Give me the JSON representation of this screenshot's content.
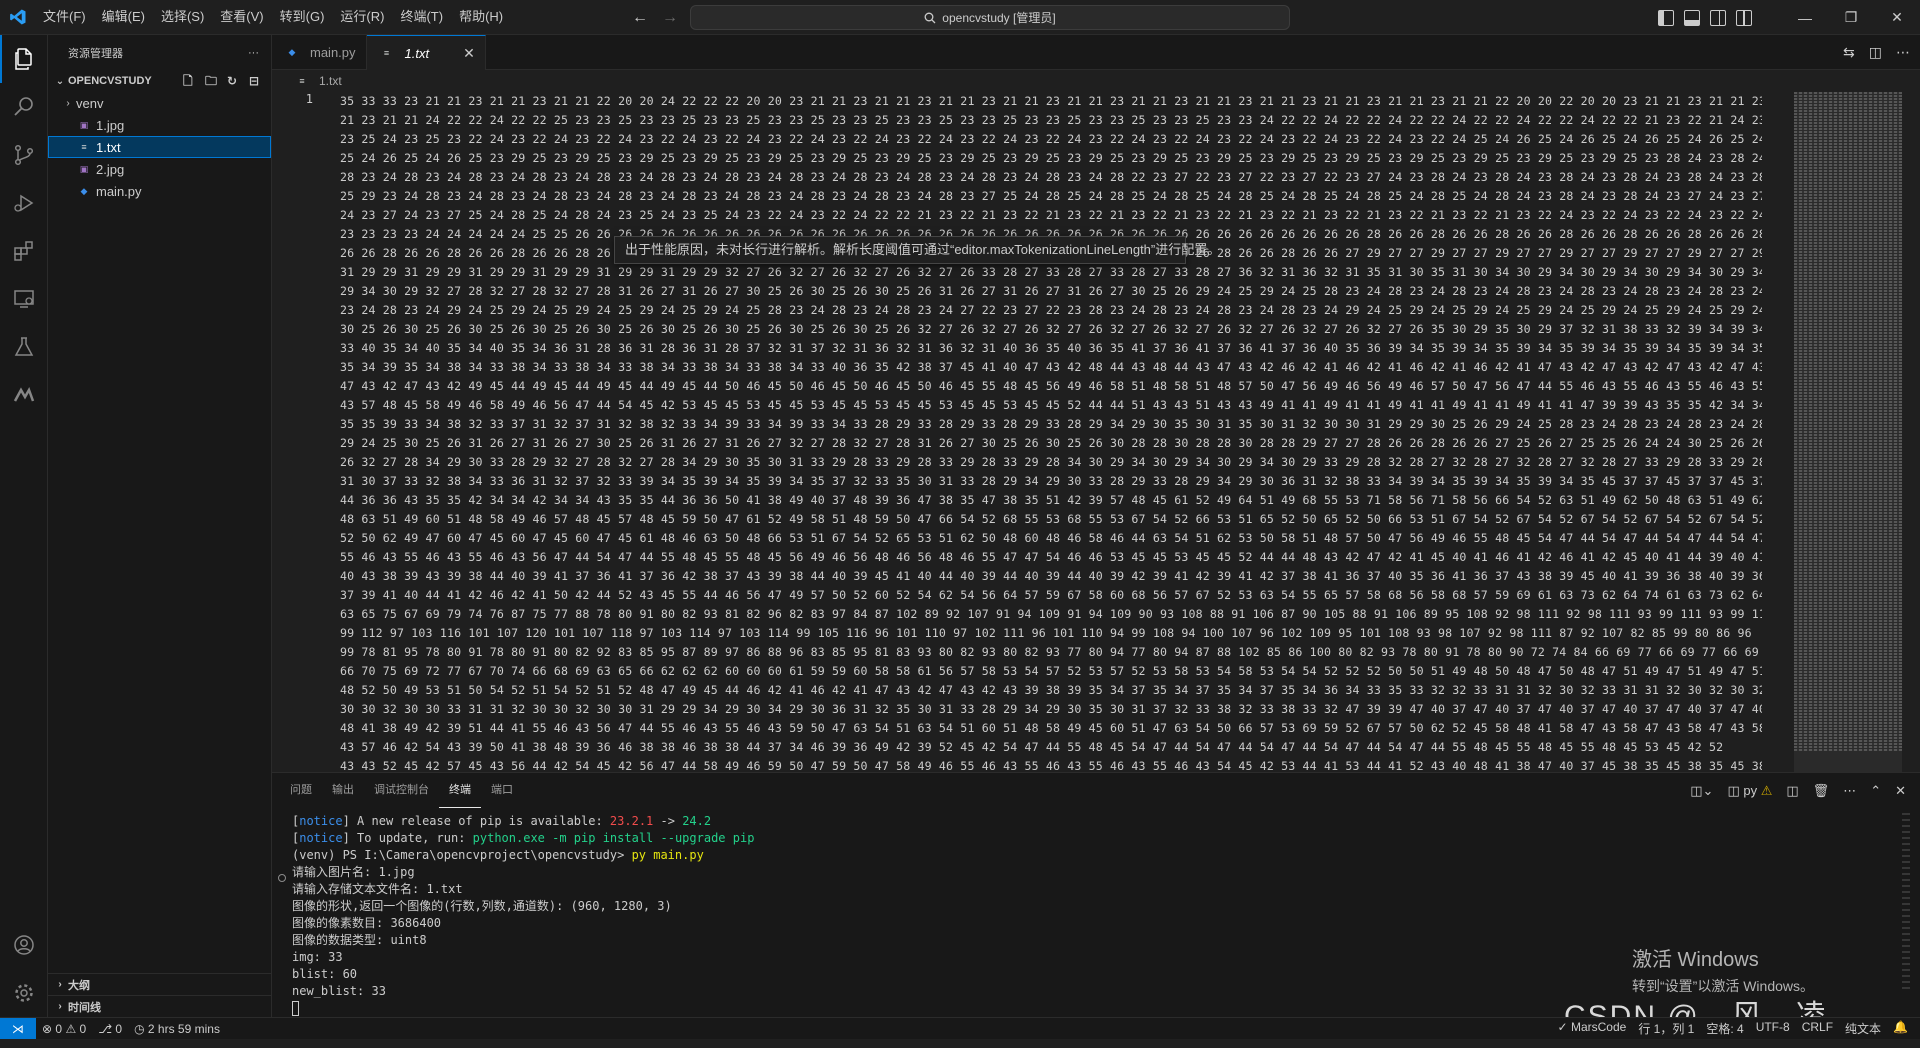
{
  "titlebar": {
    "menus": [
      "文件(F)",
      "编辑(E)",
      "选择(S)",
      "查看(V)",
      "转到(G)",
      "运行(R)",
      "终端(T)",
      "帮助(H)"
    ],
    "search_text": "opencvstudy [管理员]"
  },
  "sidebar": {
    "title": "资源管理器",
    "more": "···",
    "folder": "OPENCVSTUDY",
    "items": [
      {
        "label": "venv",
        "type": "folder"
      },
      {
        "label": "1.jpg",
        "type": "img"
      },
      {
        "label": "1.txt",
        "type": "txt",
        "selected": true
      },
      {
        "label": "2.jpg",
        "type": "img"
      },
      {
        "label": "main.py",
        "type": "py"
      }
    ],
    "outline": "大纲",
    "timeline": "时间线"
  },
  "tabs": [
    {
      "label": "main.py",
      "active": false
    },
    {
      "label": "1.txt",
      "active": true
    }
  ],
  "breadcrumb": "1.txt",
  "editor": {
    "line_number": "1",
    "tooltip": "出于性能原因，未对长行进行解析。解析长度阈值可通过“editor.maxTokenizationLineLength”进行配置。",
    "lines": [
      "35 33 33 23 21 21 23 21 21 23 21 21 22 20 20 24 22 22 22 20 20 23 21 21 23 21 21 23 21 21 23 21 21 23 21 21 23 21 21 23 21 21 23 21 21 23 21 21 23 21 21 23 21 21 22 20 20 22 20 20 23 21 21 23 21 21 23 21",
      "21 23 21 21 24 22 22 24 22 22 25 23 23 25 23 23 25 23 23 25 23 23 25 23 23 25 23 23 25 23 23 25 23 23 25 23 23 25 23 23 25 23 23 24 22 22 24 22 22 24 22 22 24 22 22 24 22 22 24 22 22 21 23 22 21 24 23 25 24",
      "23 25 24 23 25 23 22 24 23 22 24 23 22 24 23 22 24 23 22 24 23 22 24 23 22 24 23 22 24 23 22 24 23 22 24 23 22 24 23 22 24 23 22 24 23 22 24 23 22 24 23 22 24 25 24 26 25 24 26 25 24 26 25 24 26 25 24 26",
      "25 24 26 25 24 26 25 23 29 25 23 29 25 23 29 25 23 29 25 23 29 25 23 29 25 23 29 25 23 29 25 23 29 25 23 29 25 23 29 25 23 29 25 23 29 25 23 29 25 23 29 25 23 29 25 23 29 25 23 29 25 23 28 24 23 28 24 23",
      "28 23 24 28 23 24 28 23 24 28 23 24 28 23 24 28 23 24 28 23 24 28 23 24 28 23 24 28 23 24 28 23 24 28 23 24 28 22 23 27 22 23 27 22 23 27 22 23 27 24 23 28 24 23 28 24 23 28 24 23 28 24 23 28 24 23 28 24",
      "25 29 23 24 28 23 24 28 23 24 28 23 24 28 23 24 28 23 24 28 23 24 28 23 24 28 23 24 28 23 27 25 24 28 25 24 28 25 24 28 25 24 28 25 24 28 25 24 28 25 24 28 25 24 28 24 23 28 24 23 28 24 23 27 24 23 27 24",
      "24 23 27 24 23 27 25 24 28 25 24 28 24 23 25 24 23 25 24 23 22 24 23 22 24 22 22 21 23 22 21 23 22 21 23 22 21 23 22 21 23 22 21 23 22 21 23 22 21 23 22 21 23 22 21 23 22 24 23 22 24 23 22 24 23 22 24 23",
      "23 23 23 23 24 24 24 24 24 25 25 26 26 26 26 26 26 26 26 26 26 26 26 26 26 26 26 26 26 26 26 26 26 26 26 26 26 26 26 26 26 26 26 26 26 26 26 26 28 26 26 28 26 26 28 26 26 28 26 26 28 26 26 28 26 26 28 26",
      "26 26 28 26 26 28 26 26 28 26 26 28 26 26 28 26 26 28 26 26 28 26 26 28 26 26 28 26 26 28 26 26 28 26 26 28 26 26 28 26 26 28 26 26 28 26 26 27 29 27 27 29 27 27 29 27 27 29 27 27 29 27 27 29 27 27 29 27",
      "31 29 29 31 29 29 31 29 29 31 29 29 31 29 29 31 29 29 32 27 26 32 27 26 32 27 26 32 27 26 33 28 27 33 28 27 33 28 27 33 28 27 36 32 31 36 32 31 35 31 30 35 31 30 34 30 29 34 30 29 34 30 29 34 30 29 34 30",
      "29 34 30 29 32 27 28 32 27 28 32 27 28 31 26 27 31 26 27 30 25 26 30 25 26 30 25 26 31 26 27 31 26 27 31 26 27 30 25 26 29 24 25 29 24 25 28 23 24 28 23 24 28 23 24 28 23 24 28 23 24 28 23 24 28 23 24 28",
      "23 24 28 23 24 29 24 25 29 24 25 29 24 25 29 24 25 29 24 25 28 23 24 28 23 24 28 23 24 27 22 23 27 22 23 28 23 24 28 23 24 28 23 24 28 23 24 29 24 25 29 24 25 29 24 25 29 24 25 29 24 25 29 24 25 29 24 25",
      "30 25 26 30 25 26 30 25 26 30 25 26 30 25 26 30 25 26 30 25 26 30 25 26 30 25 26 32 27 26 32 27 26 32 27 26 32 27 26 32 27 26 32 27 26 32 27 26 32 27 26 35 30 29 35 30 29 37 32 31 38 33 32 39 34 39 34 39",
      "33 40 35 34 40 35 34 40 35 34 36 31 28 36 31 28 36 31 28 37 32 31 37 32 31 36 32 31 36 32 31 40 36 35 40 36 35 41 37 36 41 37 36 41 37 36 40 35 36 39 34 35 39 34 35 39 34 35 39 34 35 39 34 35 39 34 35 39",
      "35 34 39 35 34 38 34 33 38 34 33 38 34 33 38 34 33 38 34 33 38 34 33 40 36 35 42 38 37 45 41 40 47 43 42 48 44 43 48 44 43 47 43 42 46 42 41 46 42 41 46 42 41 46 42 41 47 43 42 47 43 42 47 43 42 47 43 42",
      "47 43 42 47 43 42 49 45 44 49 45 44 49 45 44 49 45 44 50 46 45 50 46 45 50 46 45 50 46 45 55 48 45 56 49 46 58 51 48 58 51 48 57 50 47 56 49 46 56 49 46 57 50 47 56 47 44 55 46 43 55 46 43 55 46 43 55 46",
      "43 57 48 45 58 49 46 58 49 46 56 47 44 54 45 42 53 45 45 53 45 45 53 45 45 53 45 45 53 45 45 53 45 45 52 44 44 51 43 43 51 43 43 49 41 41 49 41 41 49 41 41 49 41 41 49 41 41 47 39 39 43 35 35 42 34 34 43",
      "35 35 39 33 34 38 32 33 37 31 32 37 31 32 38 32 33 34 39 33 34 39 33 34 33 28 29 33 28 29 33 28 29 33 28 29 34 29 30 35 30 31 35 30 31 32 30 30 31 29 29 30 25 26 29 24 25 28 23 24 28 23 24 28 23 24 28 23",
      "29 24 25 30 25 26 31 26 27 31 26 27 30 25 26 31 26 27 31 26 27 32 27 28 32 27 28 31 26 27 30 25 26 30 25 26 30 28 28 30 28 28 30 28 28 29 27 27 28 26 26 28 26 26 27 25 26 27 25 25 26 24 24 30 25 26 26 24",
      "26 32 27 28 34 29 30 33 28 29 32 27 28 32 27 28 34 29 30 35 30 31 33 29 28 33 29 28 33 29 28 33 29 28 34 30 29 34 30 29 34 30 29 34 30 29 33 29 28 32 28 27 32 28 27 32 28 27 32 28 27 33 29 28 33 29 28 33",
      "31 30 37 33 32 38 34 33 36 31 32 37 32 33 39 34 35 39 34 35 39 34 35 37 32 33 35 30 31 33 28 29 34 29 30 33 28 29 33 28 29 34 29 30 36 31 32 38 33 34 39 34 35 39 34 35 39 34 35 45 37 37 45 37 37 45 37 37",
      "44 36 36 43 35 35 42 34 34 42 34 34 43 35 35 44 36 36 50 41 38 49 40 37 48 39 36 47 38 35 47 38 35 51 42 39 57 48 45 61 52 49 64 51 49 68 55 53 71 58 56 71 58 56 66 54 52 63 51 49 62 50 48 63 51 49 62 50",
      "48 63 51 49 60 51 48 58 49 46 57 48 45 57 48 45 59 50 47 61 52 49 58 51 48 59 50 47 66 54 52 68 55 53 68 55 53 67 54 52 66 53 51 65 52 50 65 52 50 66 53 51 67 54 52 67 54 52 67 54 52 67 54 52 67 54 52 65",
      "52 50 62 49 47 60 47 45 60 47 45 60 47 45 61 48 46 63 50 48 66 53 51 67 54 52 65 53 51 62 50 48 60 48 46 58 46 44 63 54 51 62 53 50 58 51 48 57 50 47 56 49 46 55 48 45 54 47 44 54 47 44 54 47 44 54 47 44",
      "55 46 43 55 46 43 55 46 43 56 47 44 54 47 44 55 48 45 55 48 45 56 49 46 56 48 46 56 48 46 55 47 47 54 46 46 53 45 45 53 45 45 52 44 44 48 43 42 47 42 41 45 40 41 46 41 42 46 41 42 45 40 41 44 39 40 41 44",
      "40 43 38 39 43 39 38 44 40 39 41 37 36 41 37 36 42 38 37 43 39 38 44 40 39 45 41 40 44 40 39 44 40 39 44 40 39 42 39 41 42 39 41 42 37 38 41 36 37 40 35 36 41 36 37 43 38 39 45 40 41 39 36 38 40 39 36 38",
      "37 39 41 40 44 41 42 46 42 41 50 42 44 52 43 45 55 44 46 56 47 49 57 50 52 60 52 54 62 54 56 64 57 59 67 58 60 68 56 57 67 52 53 63 54 55 65 57 58 68 56 58 68 57 59 69 61 63 73 62 64 74 61 63 73 62 64 74",
      "63 65 75 67 69 79 74 76 87 75 77 88 78 80 91 80 82 93 81 82 96 82 83 97 84 87 102 89 92 107 91 94 109 91 94 109 90 93 108 88 91 106 87 90 105 88 91 106 89 95 108 92 98 111 92 98 111 93 99 111 93 99 111",
      "99 112 97 103 116 101 107 120 101 107 118 97 103 114 97 103 114 99 105 116 96 101 110 97 102 111 96 101 110 94 99 108 94 100 107 96 102 109 95 101 108 93 98 107 92 98 111 87 92 107 82 85 99 80 86 96",
      "99 78 81 95 78 80 91 78 80 91 80 82 92 83 85 95 87 89 97 86 88 96 83 85 95 81 83 93 80 82 93 80 82 93 77 80 94 77 80 94 87 88 102 85 86 100 80 82 93 78 80 91 78 80 90 72 74 84 66 69 77 66 69 77 66 69",
      "66 70 75 69 72 77 67 70 74 66 68 69 63 65 66 62 62 62 60 60 60 61 59 59 60 58 58 61 56 57 58 53 54 57 52 53 57 52 53 58 53 54 58 53 54 54 52 52 52 50 50 51 49 48 50 48 47 50 48 47 51 49 47 51 49 47 51 49",
      "48 52 50 49 53 51 50 54 52 51 54 52 51 52 48 47 49 45 44 46 42 41 46 42 41 47 43 42 47 43 42 43 39 38 39 35 34 37 35 34 37 35 34 37 35 34 36 34 33 35 33 32 32 33 31 31 32 30 32 33 31 31 32 30 32 30 32 30",
      "30 30 32 30 30 33 31 31 32 30 30 32 30 30 31 29 29 34 29 30 34 29 30 36 31 32 35 30 31 33 28 29 34 29 30 35 30 31 37 32 33 38 32 33 38 33 32 47 39 39 47 40 37 47 40 37 47 40 37 47 40 37 47 40 37 47 40 37",
      "48 41 38 49 42 39 51 44 41 55 46 43 56 47 44 55 46 43 55 46 43 59 50 47 63 54 51 63 54 51 60 51 48 58 49 45 60 51 47 63 54 50 66 57 53 69 59 52 67 57 50 62 52 45 58 48 41 58 47 43 58 47 43 58 47 43 58 47",
      "43 57 46 42 54 43 39 50 41 38 48 39 36 46 38 38 46 38 38 44 37 34 46 39 36 49 42 39 52 45 42 54 47 44 55 48 45 54 47 44 54 47 44 54 47 44 54 47 44 54 47 44 55 48 45 55 48 45 55 48 45 53 45 42 52",
      "43 43 52 45 42 57 45 43 56 44 42 54 45 42 56 47 44 58 49 46 59 50 47 59 50 47 58 49 46 55 46 43 55 46 43 55 46 43 55 46 43 54 45 42 53 44 41 53 44 41 52 43 40 48 41 38 47 40 37 45 38 35 45 38 35 45 38"
    ]
  },
  "panel": {
    "tabs": [
      "问题",
      "输出",
      "调试控制台",
      "终端",
      "端口"
    ],
    "active_tab": "终端",
    "shell_label": "py",
    "terminal": {
      "notice1_tag": "notice",
      "notice1_text": " A new release of pip is available: ",
      "notice1_old": "23.2.1",
      "notice1_arrow": " -> ",
      "notice1_new": "24.2",
      "notice2_tag": "notice",
      "notice2_text": " To update, run: ",
      "notice2_cmd": "python.exe -m pip install --upgrade pip",
      "prompt_env": "(venv) PS I:\\Camera\\opencvproject\\opencvstudy> ",
      "prompt_cmd": "py main.py",
      "output": [
        "请输入图片名: 1.jpg",
        "请输入存储文本文件名: 1.txt",
        "图像的形状,返回一个图像的(行数,列数,通道数): (960, 1280, 3)",
        "图像的像素数目: 3686400",
        "图像的数据类型: uint8",
        "img: 33",
        "blist: 60",
        "new_blist: 33"
      ]
    },
    "watermark_line1": "激活 Windows",
    "watermark_line2": "转到“设置”以激活 Windows。",
    "csdn": "CSDN @　风　凌"
  },
  "statusbar": {
    "errors": "0",
    "warnings": "0",
    "ports": "0",
    "time": "2 hrs 59 mins",
    "marscode": "MarsCode",
    "position": "行 1，列 1",
    "spaces": "空格: 4",
    "encoding": "UTF-8",
    "eol": "CRLF",
    "language": "纯文本"
  }
}
